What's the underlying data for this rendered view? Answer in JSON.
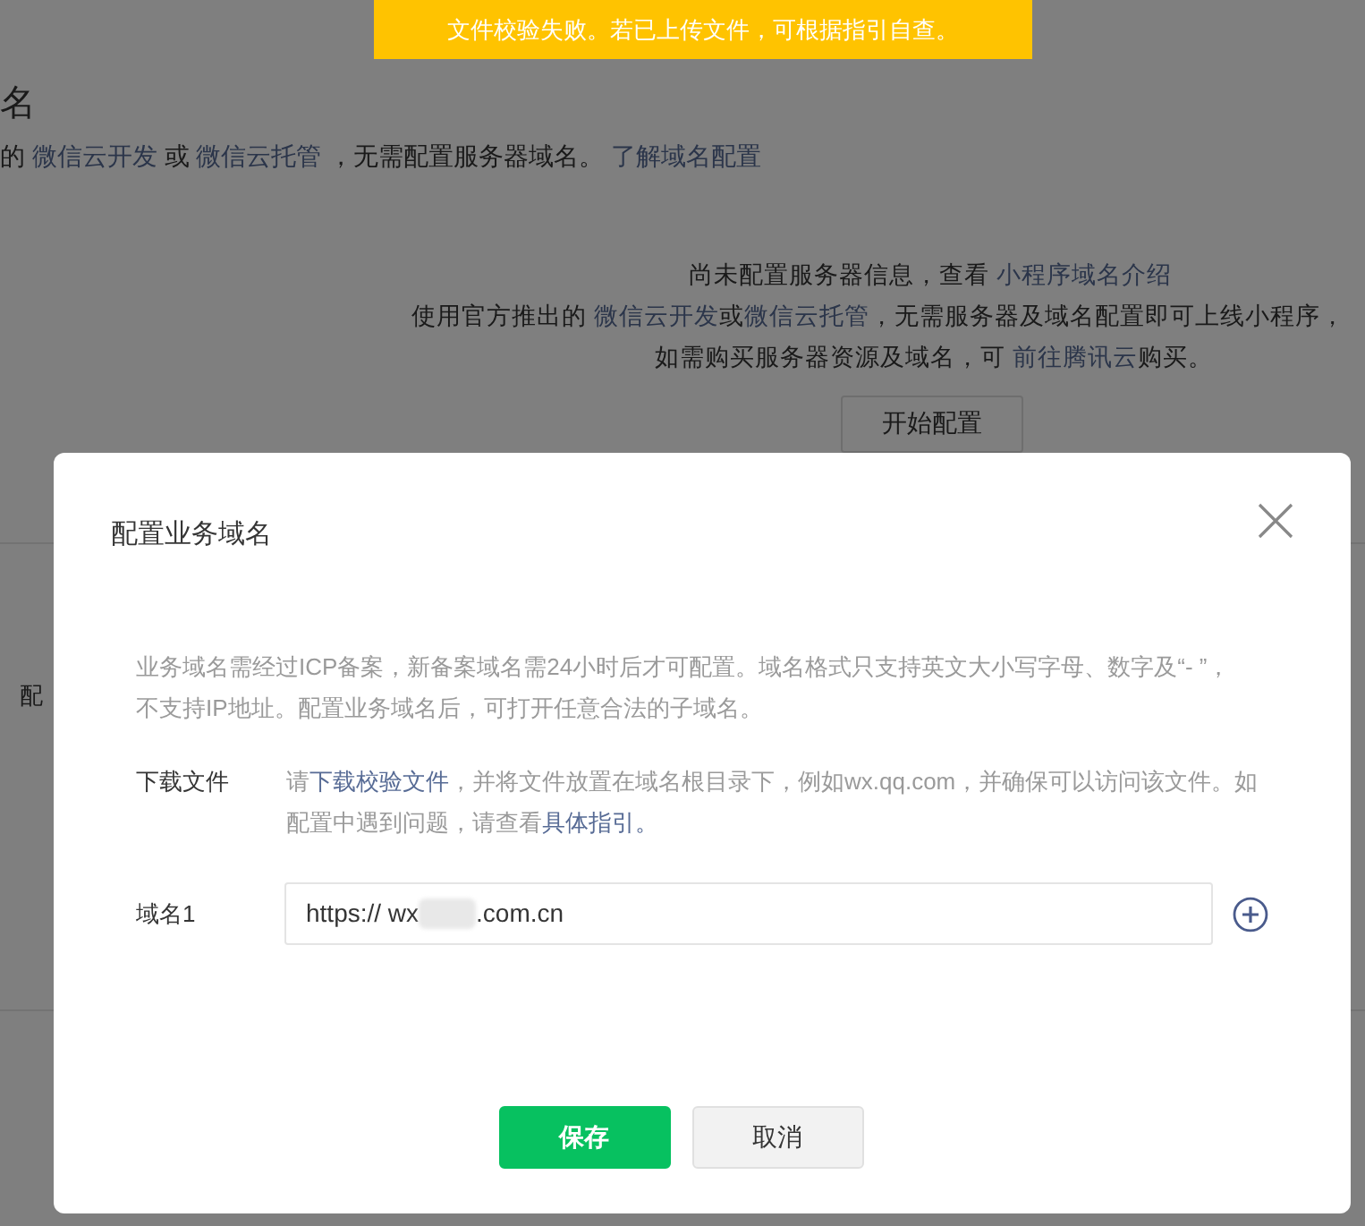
{
  "banner": {
    "text": "文件校验失败。若已上传文件，可根据指引自查。"
  },
  "page": {
    "heading": "名",
    "intro": [
      {
        "text": "的 ",
        "link": false
      },
      {
        "text": "微信云开发",
        "link": true
      },
      {
        "text": " 或 ",
        "link": false
      },
      {
        "text": "微信云托管",
        "link": true
      },
      {
        "text": " ，无需配置服务器域名。 ",
        "link": false
      },
      {
        "text": "了解域名配置",
        "link": true
      }
    ],
    "notice_lines": [
      [
        {
          "text": "尚未配置服务器信息，查看 ",
          "link": false
        },
        {
          "text": "小程序域名介绍",
          "link": true
        }
      ],
      [
        {
          "text": "使用官方推出的 ",
          "link": false
        },
        {
          "text": "微信云开发",
          "link": true
        },
        {
          "text": "或",
          "link": false
        },
        {
          "text": "微信云托管",
          "link": true
        },
        {
          "text": "，无需服务器及域名配置即可上线小程序，",
          "link": false
        }
      ],
      [
        {
          "text": "如需购买服务器资源及域名，可 ",
          "link": false
        },
        {
          "text": "前往腾讯云",
          "link": true
        },
        {
          "text": "购买。",
          "link": false
        }
      ]
    ],
    "start_button": "开始配置",
    "side_label": "配"
  },
  "dialog": {
    "title": "配置业务域名",
    "description": "业务域名需经过ICP备案，新备案域名需24小时后才可配置。域名格式只支持英文大小写字母、数字及“- ”，不支持IP地址。配置业务域名后，可打开任意合法的子域名。",
    "rows": [
      {
        "label": "下载文件",
        "kind": "text",
        "parts": [
          {
            "text": "请",
            "link": false
          },
          {
            "text": "下载校验文件",
            "link": true
          },
          {
            "text": "，并将文件放置在域名根目录下，例如wx.qq.com，并确保可以访问该文件。如配置中遇到问题，请查看",
            "link": false
          },
          {
            "text": "具体指引。",
            "link": true
          }
        ]
      },
      {
        "label": "域名1",
        "kind": "field",
        "value_start": "https:// wx",
        "value_end": ".com.cn"
      }
    ],
    "buttons": [
      {
        "label": "保存",
        "kind": "primary"
      },
      {
        "label": "取消",
        "kind": "default"
      }
    ]
  }
}
